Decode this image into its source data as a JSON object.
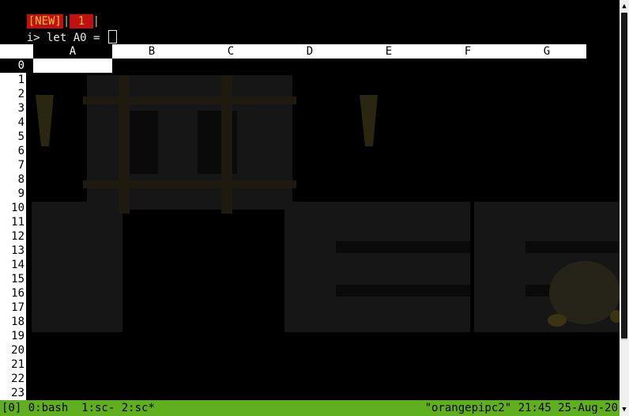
{
  "tmux_tabs": {
    "new_label": "[NEW]",
    "separator": "|",
    "tab1_label": " 1 ",
    "trailing_separator": "|"
  },
  "command": {
    "prompt": "i> let A0 = "
  },
  "spreadsheet": {
    "columns": [
      "A",
      "B",
      "C",
      "D",
      "E",
      "F",
      "G"
    ],
    "selected_column": "A",
    "rows": [
      "0",
      "1",
      "2",
      "3",
      "4",
      "5",
      "6",
      "7",
      "8",
      "9",
      "10",
      "11",
      "12",
      "13",
      "14",
      "15",
      "16",
      "17",
      "18",
      "19",
      "20",
      "21",
      "22",
      "23"
    ],
    "selected_row": "0"
  },
  "status_bar": {
    "left": "[0] 0:bash  1:sc- 2:sc*",
    "right": "\"orangepipc2\" 21:45 25-Aug-20",
    "color": "#5faf1f"
  },
  "scrollbar": {
    "up_arrow": "▲",
    "down_arrow": "▼"
  }
}
